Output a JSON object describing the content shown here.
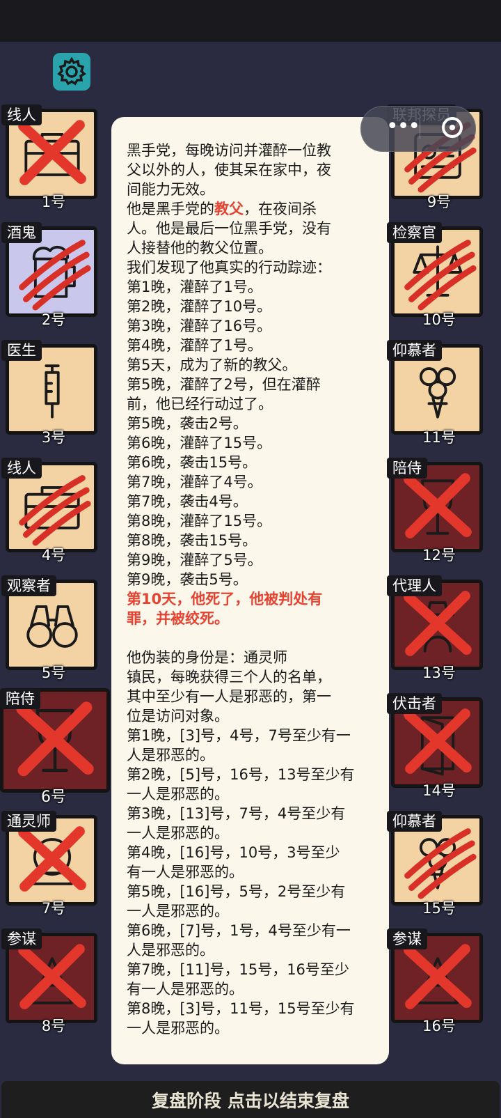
{
  "bottom_bar": {
    "label": "复盘阶段 点击以结束复盘"
  },
  "icons": {
    "settings": "gear-icon",
    "capsule_more": "more-dots-icon",
    "capsule_close": "close-circle-icon"
  },
  "colors": {
    "dead_card": "#6e2226",
    "live_card": "#f3d2a4",
    "accent_red": "#e64332",
    "background": "#2a2b40"
  },
  "players": [
    {
      "number": "1号",
      "role": "线人",
      "mark": "cross",
      "art": "briefcase-icon",
      "tone": "light"
    },
    {
      "number": "2号",
      "role": "酒鬼",
      "mark": "claw",
      "art": "beer-icon",
      "tone": "lav"
    },
    {
      "number": "3号",
      "role": "医生",
      "mark": "none",
      "art": "syringe-icon",
      "tone": "light"
    },
    {
      "number": "4号",
      "role": "线人",
      "mark": "claw",
      "art": "briefcase-icon",
      "tone": "light"
    },
    {
      "number": "5号",
      "role": "观察者",
      "mark": "none",
      "art": "binoculars-icon",
      "tone": "light"
    },
    {
      "number": "6号",
      "role": "陪侍",
      "mark": "cross",
      "art": "wineglass-icon",
      "tone": "dark"
    },
    {
      "number": "7号",
      "role": "通灵师",
      "mark": "cross",
      "art": "crystal-ball-icon",
      "tone": "light"
    },
    {
      "number": "8号",
      "role": "参谋",
      "mark": "cross",
      "art": "strategist-icon",
      "tone": "dark"
    },
    {
      "number": "9号",
      "role": "联邦探员",
      "mark": "claw",
      "art": "badge-icon",
      "tone": "light"
    },
    {
      "number": "10号",
      "role": "检察官",
      "mark": "claw",
      "art": "scales-icon",
      "tone": "light"
    },
    {
      "number": "11号",
      "role": "仰慕者",
      "mark": "none",
      "art": "bouquet-icon",
      "tone": "light"
    },
    {
      "number": "12号",
      "role": "陪侍",
      "mark": "cross",
      "art": "wineglass-icon",
      "tone": "dark"
    },
    {
      "number": "13号",
      "role": "代理人",
      "mark": "cross",
      "art": "agent-icon",
      "tone": "dark"
    },
    {
      "number": "14号",
      "role": "伏击者",
      "mark": "cross",
      "art": "door-icon",
      "tone": "dark"
    },
    {
      "number": "15号",
      "role": "仰慕者",
      "mark": "claw",
      "art": "bouquet-icon",
      "tone": "light"
    },
    {
      "number": "16号",
      "role": "参谋",
      "mark": "cross",
      "art": "strategist-icon",
      "tone": "dark"
    }
  ],
  "review": {
    "lines": [
      {
        "text": "黑手党，每晚访问并灌醉一位教"
      },
      {
        "text": "父以外的人，使其呆在家中，夜"
      },
      {
        "text": "间能力无效。"
      },
      {
        "pre": "他是黑手党的",
        "hl": "教父",
        "post": "，在夜间杀"
      },
      {
        "text": "人。他是最后一位黑手党，没有"
      },
      {
        "text": "人接替他的教父位置。"
      },
      {
        "text": "我们发现了他真实的行动踪迹："
      },
      {
        "text": "第1晚，灌醉了1号。"
      },
      {
        "text": "第2晚，灌醉了10号。"
      },
      {
        "text": "第3晚，灌醉了16号。"
      },
      {
        "text": "第4晚，灌醉了1号。"
      },
      {
        "text": "第5天，成为了新的教父。"
      },
      {
        "text": "第5晚，灌醉了2号，但在灌醉"
      },
      {
        "text": "前，他已经行动过了。"
      },
      {
        "text": "第5晚，袭击2号。"
      },
      {
        "text": "第6晚，灌醉了15号。"
      },
      {
        "text": "第6晚，袭击15号。"
      },
      {
        "text": "第7晚，灌醉了4号。"
      },
      {
        "text": "第7晚，袭击4号。"
      },
      {
        "text": "第8晚，灌醉了15号。"
      },
      {
        "text": "第8晚，袭击15号。"
      },
      {
        "text": "第9晚，灌醉了5号。"
      },
      {
        "text": "第9晚，袭击5号。"
      },
      {
        "text": "第10天，他死了，他被判处有",
        "red": true
      },
      {
        "text": "罪，并被绞死。",
        "red": true
      },
      {
        "text": ""
      },
      {
        "text": "他伪装的身份是：通灵师"
      },
      {
        "text": "镇民，每晚获得三个人的名单，"
      },
      {
        "text": "其中至少有一人是邪恶的，第一"
      },
      {
        "text": "位是访问对象。"
      },
      {
        "text": "第1晚，[3]号，4号，7号至少有一"
      },
      {
        "text": "人是邪恶的。"
      },
      {
        "text": "第2晚，[5]号，16号，13号至少有"
      },
      {
        "text": "一人是邪恶的。"
      },
      {
        "text": "第3晚，[13]号，7号，4号至少有"
      },
      {
        "text": "一人是邪恶的。"
      },
      {
        "text": "第4晚，[16]号，10号，3号至少"
      },
      {
        "text": "有一人是邪恶的。"
      },
      {
        "text": "第5晚，[16]号，5号，2号至少有"
      },
      {
        "text": "一人是邪恶的。"
      },
      {
        "text": "第6晚，[7]号，1号，4号至少有一"
      },
      {
        "text": "人是邪恶的。"
      },
      {
        "text": "第7晚，[11]号，15号，16号至少"
      },
      {
        "text": "有一人是邪恶的。"
      },
      {
        "text": "第8晚，[3]号，11号，15号至少有"
      },
      {
        "text": "一人是邪恶的。"
      }
    ]
  }
}
